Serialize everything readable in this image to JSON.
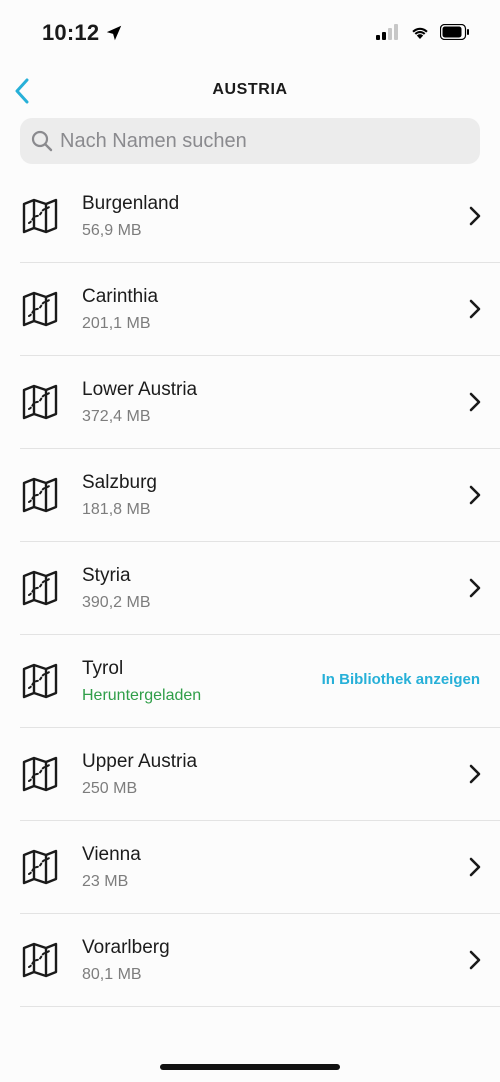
{
  "status": {
    "time": "10:12"
  },
  "nav": {
    "title": "AUSTRIA"
  },
  "search": {
    "placeholder": "Nach Namen suchen",
    "value": ""
  },
  "regions": [
    {
      "name": "Burgenland",
      "sub": "56,9 MB"
    },
    {
      "name": "Carinthia",
      "sub": "201,1 MB"
    },
    {
      "name": "Lower Austria",
      "sub": "372,4 MB"
    },
    {
      "name": "Salzburg",
      "sub": "181,8 MB"
    },
    {
      "name": "Styria",
      "sub": "390,2 MB"
    },
    {
      "name": "Tyrol",
      "sub": "Heruntergeladen",
      "action": "In Bibliothek anzeigen"
    },
    {
      "name": "Upper Austria",
      "sub": "250 MB"
    },
    {
      "name": "Vienna",
      "sub": "23 MB"
    },
    {
      "name": "Vorarlberg",
      "sub": "80,1 MB"
    }
  ],
  "colors": {
    "accent": "#27b0d8",
    "downloaded": "#2f9e48"
  },
  "icons": {
    "row": "map-icon",
    "trailing": "chevron-right-icon",
    "back": "chevron-left-icon"
  }
}
